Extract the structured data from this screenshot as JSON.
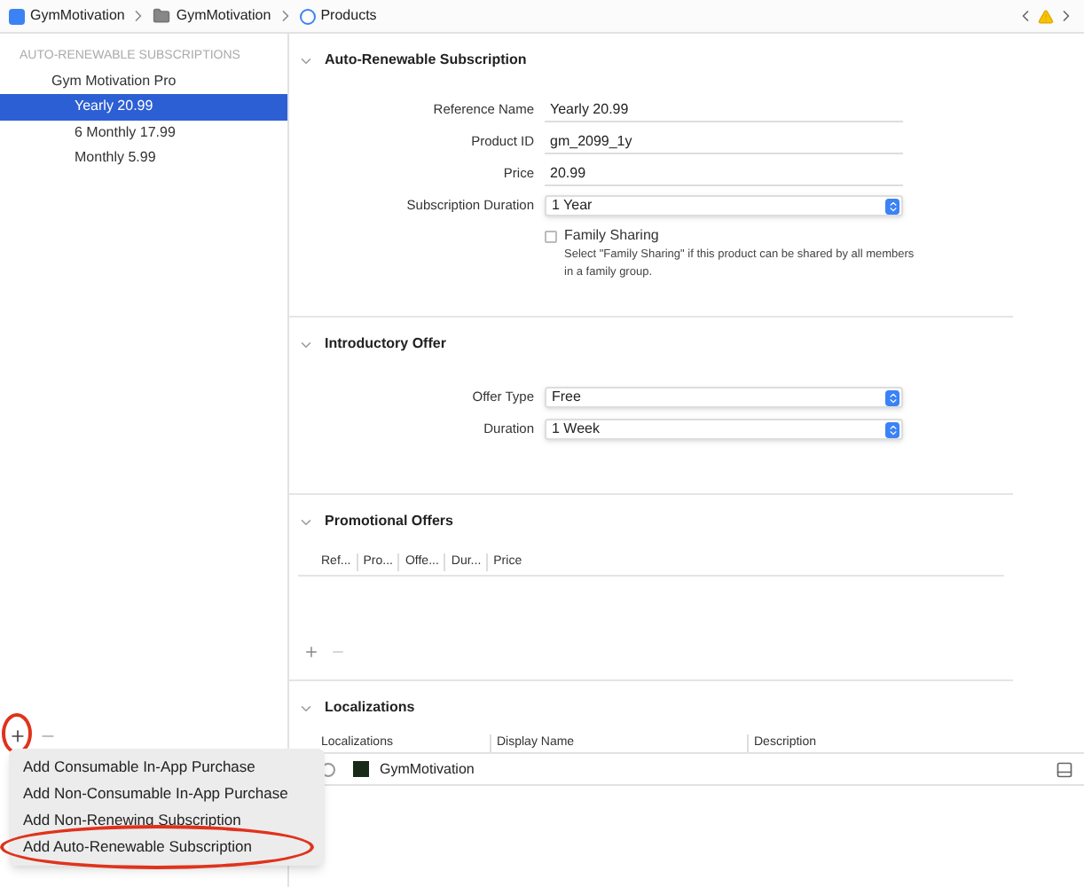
{
  "breadcrumbs": [
    {
      "kind": "app",
      "label": "GymMotivation"
    },
    {
      "kind": "folder",
      "label": "GymMotivation"
    },
    {
      "kind": "storekit",
      "label": "Products"
    }
  ],
  "toolbar": {
    "warning": true
  },
  "sidebar": {
    "header": "AUTO-RENEWABLE SUBSCRIPTIONS",
    "groups": [
      {
        "label": "Gym Motivation Pro",
        "children": [
          {
            "label": "Yearly 20.99",
            "selected": true
          },
          {
            "label": "6 Monthly 17.99",
            "selected": false
          },
          {
            "label": "Monthly 5.99",
            "selected": false
          }
        ]
      }
    ],
    "add_annotated": true
  },
  "sections": [
    {
      "kind": "form",
      "title": "Auto-Renewable Subscription",
      "expanded": true,
      "fields": [
        {
          "kind": "text",
          "label": "Reference Name",
          "value": "Yearly 20.99"
        },
        {
          "kind": "text",
          "label": "Product ID",
          "value": "gm_2099_1y"
        },
        {
          "kind": "text",
          "label": "Price",
          "value": "20.99"
        },
        {
          "kind": "select",
          "label": "Subscription Duration",
          "value": "1 Year"
        },
        {
          "kind": "checkbox",
          "label": "Family Sharing",
          "checked": false,
          "help": "Select \"Family Sharing\" if this product can be shared by all members in a family group."
        }
      ]
    },
    {
      "kind": "form",
      "title": "Introductory Offer",
      "expanded": true,
      "fields": [
        {
          "kind": "select",
          "label": "Offer Type",
          "value": "Free"
        },
        {
          "kind": "select",
          "label": "Duration",
          "value": "1 Week"
        }
      ]
    },
    {
      "kind": "table",
      "title": "Promotional Offers",
      "expanded": true,
      "columns": [
        "Ref...",
        "Pro...",
        "Offe...",
        "Dur...",
        "Price"
      ]
    },
    {
      "kind": "partial",
      "title": "Localizations",
      "expanded": true,
      "columns": [
        "Localizations",
        "Display Name",
        "Description"
      ]
    }
  ],
  "scheme_bar": {
    "label": "GymMotivation"
  },
  "add_menu": [
    {
      "label": "Add Consumable In-App Purchase",
      "annotated": false
    },
    {
      "label": "Add Non-Consumable In-App Purchase",
      "annotated": false
    },
    {
      "label": "Add Non-Renewing Subscription",
      "annotated": false
    },
    {
      "label": "Add Auto-Renewable Subscription",
      "annotated": true
    }
  ]
}
